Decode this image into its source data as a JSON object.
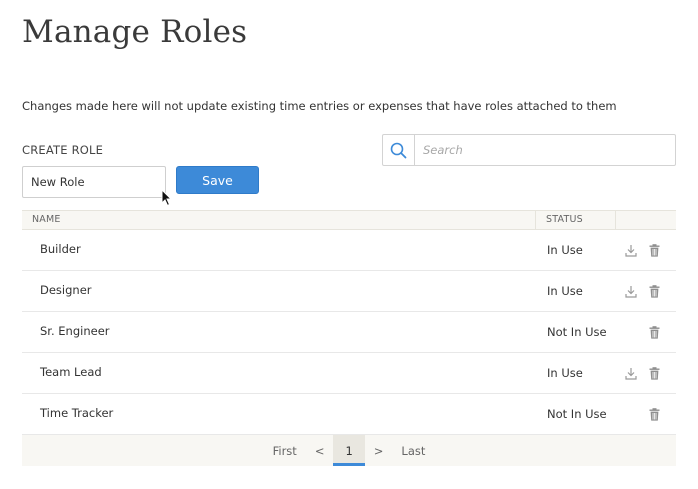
{
  "page": {
    "title": "Manage Roles",
    "notice": "Changes made here will not update existing time entries or expenses that have roles attached to them"
  },
  "create_role": {
    "label": "CREATE ROLE",
    "input_value": "New Role",
    "save_label": "Save"
  },
  "search": {
    "placeholder": "Search",
    "icon": "search-icon"
  },
  "table": {
    "columns": [
      "NAME",
      "STATUS"
    ],
    "rows": [
      {
        "name": "Builder",
        "status": "In Use",
        "actions": [
          "download-icon",
          "trash-icon"
        ]
      },
      {
        "name": "Designer",
        "status": "In Use",
        "actions": [
          "download-icon",
          "trash-icon"
        ]
      },
      {
        "name": "Sr. Engineer",
        "status": "Not In Use",
        "actions": [
          "trash-icon"
        ]
      },
      {
        "name": "Team Lead",
        "status": "In Use",
        "actions": [
          "download-icon",
          "trash-icon"
        ]
      },
      {
        "name": "Time Tracker",
        "status": "Not In Use",
        "actions": [
          "trash-icon"
        ]
      }
    ]
  },
  "pagination": {
    "first": "First",
    "prev": "<",
    "current": "1",
    "next": ">",
    "last": "Last"
  },
  "colors": {
    "accent": "#3d8ad8",
    "header_bg": "#f8f7f3",
    "icon": "#9a9a9a"
  }
}
